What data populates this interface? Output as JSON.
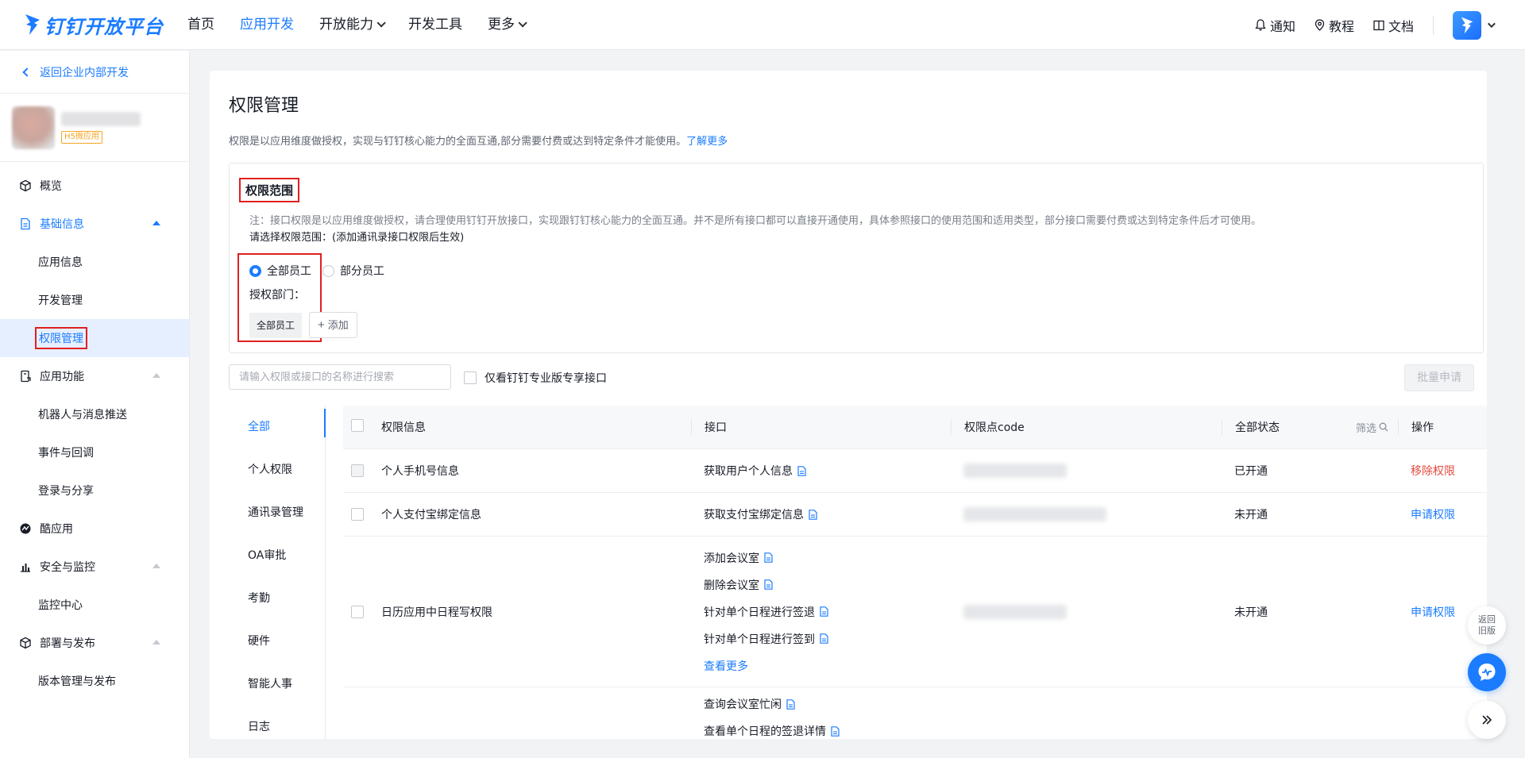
{
  "brand": {
    "name": "钉钉开放平台",
    "color": "#1b7cff"
  },
  "topnav": {
    "items": [
      {
        "label": "首页"
      },
      {
        "label": "应用开发",
        "active": true
      },
      {
        "label": "开放能力"
      },
      {
        "label": "开发工具"
      },
      {
        "label": "更多"
      }
    ],
    "right": {
      "notify": "通知",
      "tutorial": "教程",
      "docs": "文档"
    }
  },
  "sidebar": {
    "back": "返回企业内部开发",
    "app_tag": "H5微应用",
    "menu": [
      {
        "label": "概览",
        "icon": "cube-icon"
      },
      {
        "label": "基础信息",
        "icon": "document-icon",
        "open": true,
        "children": [
          {
            "label": "应用信息"
          },
          {
            "label": "开发管理"
          },
          {
            "label": "权限管理",
            "active": true
          }
        ]
      },
      {
        "label": "应用功能",
        "icon": "phone-doc-icon",
        "children": [
          {
            "label": "机器人与消息推送"
          },
          {
            "label": "事件与回调"
          },
          {
            "label": "登录与分享"
          }
        ]
      },
      {
        "label": "酷应用",
        "icon": "cool-app-icon"
      },
      {
        "label": "安全与监控",
        "icon": "bar-chart-icon",
        "children": [
          {
            "label": "监控中心"
          }
        ]
      },
      {
        "label": "部署与发布",
        "icon": "cube-icon",
        "children": [
          {
            "label": "版本管理与发布"
          }
        ]
      }
    ]
  },
  "page": {
    "title": "权限管理",
    "desc": "权限是以应用维度做授权，实现与钉钉核心能力的全面互通,部分需要付费或达到特定条件才能使用。",
    "learn_more": "了解更多"
  },
  "scope": {
    "title": "权限范围",
    "note": "注：接口权限是以应用维度做授权，请合理使用钉钉开放接口，实现跟钉钉核心能力的全面互通。并不是所有接口都可以直接开通使用，具体参照接口的使用范围和适用类型，部分接口需要付费或达到特定条件后才可使用。",
    "choose": "请选择权限范围：(添加通讯录接口权限后生效)",
    "options": [
      {
        "label": "全部员工",
        "selected": true
      },
      {
        "label": "部分员工",
        "selected": false
      }
    ],
    "auth_dept_label": "授权部门：",
    "dept_tag": "全部员工",
    "add_label": "添加"
  },
  "toolbar": {
    "search_placeholder": "请输入权限或接口的名称进行搜索",
    "only_pro": "仅看钉钉专业版专享接口",
    "batch": "批量申请"
  },
  "categories": [
    "全部",
    "个人权限",
    "通讯录管理",
    "OA审批",
    "考勤",
    "硬件",
    "智能人事",
    "日志"
  ],
  "table": {
    "headers": {
      "info": "权限信息",
      "api": "接口",
      "code": "权限点code",
      "status": "全部状态",
      "filter": "筛选",
      "op": "操作"
    },
    "rows": [
      {
        "info": "个人手机号信息",
        "apis": [
          "获取用户个人信息"
        ],
        "status": "已开通",
        "op": "移除权限",
        "op_type": "remove",
        "checkbox_disabled": true
      },
      {
        "info": "个人支付宝绑定信息",
        "apis": [
          "获取支付宝绑定信息"
        ],
        "status": "未开通",
        "op": "申请权限",
        "op_type": "apply"
      },
      {
        "info": "日历应用中日程写权限",
        "apis": [
          "添加会议室",
          "删除会议室",
          "针对单个日程进行签退",
          "针对单个日程进行签到"
        ],
        "more": "查看更多",
        "status": "未开通",
        "op": "申请权限",
        "op_type": "apply"
      },
      {
        "info": "",
        "apis": [
          "查询会议室忙闲",
          "查看单个日程的签退详情"
        ],
        "status": "",
        "op": ""
      }
    ]
  },
  "float": {
    "back_old": "返回旧版"
  }
}
